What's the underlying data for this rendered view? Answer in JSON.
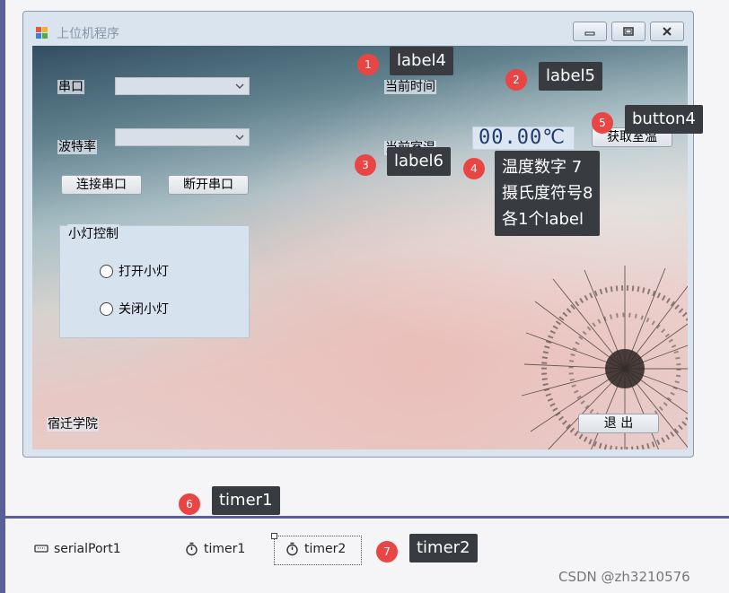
{
  "form": {
    "title": "上位机程序",
    "labels": {
      "port": "串口",
      "baud": "波特率",
      "current_time": "当前时间",
      "current_temp": "当前室温",
      "school": "宿迁学院"
    },
    "buttons": {
      "connect": "连接串口",
      "disconnect": "断开串口",
      "get_temp": "获取室温",
      "exit": "退  出"
    },
    "group": {
      "title": "小灯控制",
      "radio_on": "打开小灯",
      "radio_off": "关闭小灯"
    },
    "temp_display": "00.00℃"
  },
  "annotations": [
    {
      "number": "1",
      "text": "label4"
    },
    {
      "number": "2",
      "text": "label5"
    },
    {
      "number": "3",
      "text": "label6"
    },
    {
      "number": "4",
      "lines": [
        "温度数字 7",
        "摄氏度符号8",
        "各1个label"
      ]
    },
    {
      "number": "5",
      "text": "button4"
    },
    {
      "number": "6",
      "text": "timer1"
    },
    {
      "number": "7",
      "text": "timer2"
    }
  ],
  "components": [
    "serialPort1",
    "timer1",
    "timer2"
  ],
  "watermark": "CSDN @zh3210576",
  "colors": {
    "badge": "#e94545",
    "callout_bg": "#383b40",
    "accent_strip": "#5b5f99"
  }
}
